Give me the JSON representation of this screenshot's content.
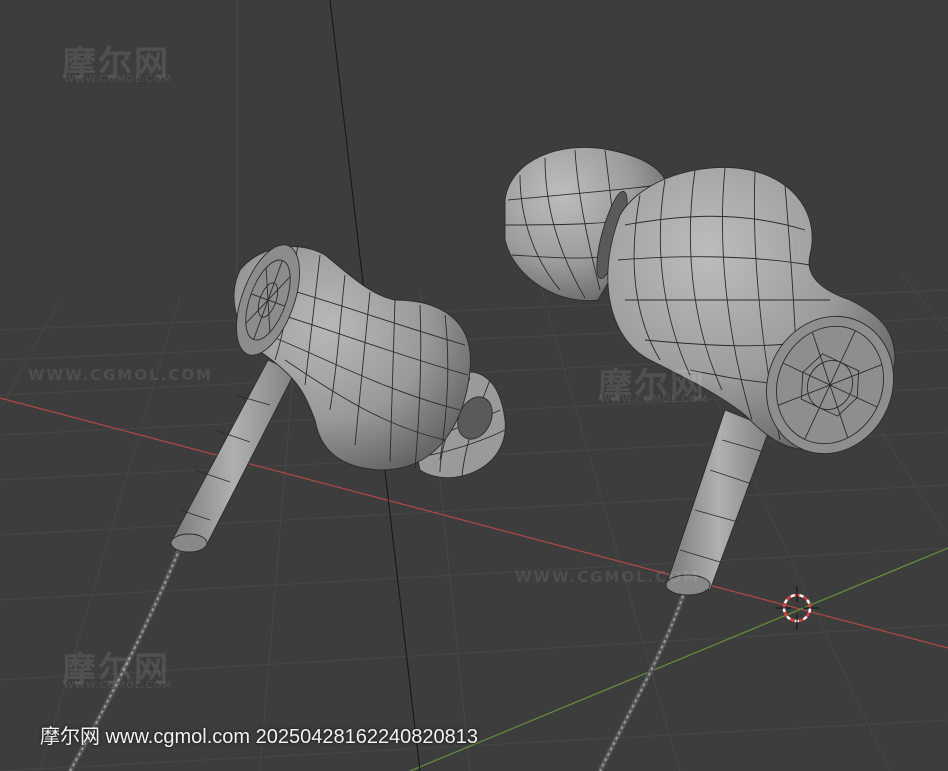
{
  "watermark": {
    "brand_cn": "摩尔网",
    "brand_url": "WWW.CGMOL.COM",
    "long_text": "WWW.CGMOL.COM"
  },
  "footer": {
    "caption": "摩尔网 www.cgmol.com 20250428162240820813"
  },
  "colors": {
    "background": "#3d3d3d",
    "grid": "#4a4a4a",
    "x_axis": "#b94a4a",
    "y_axis": "#6a9a3a",
    "mesh": "#9a9a9a",
    "wire": "#2a2a2a",
    "cursor": "#e04040"
  },
  "scene": {
    "object": "earphones-wireframe-mesh",
    "icons": [
      "3d-cursor-icon"
    ]
  }
}
